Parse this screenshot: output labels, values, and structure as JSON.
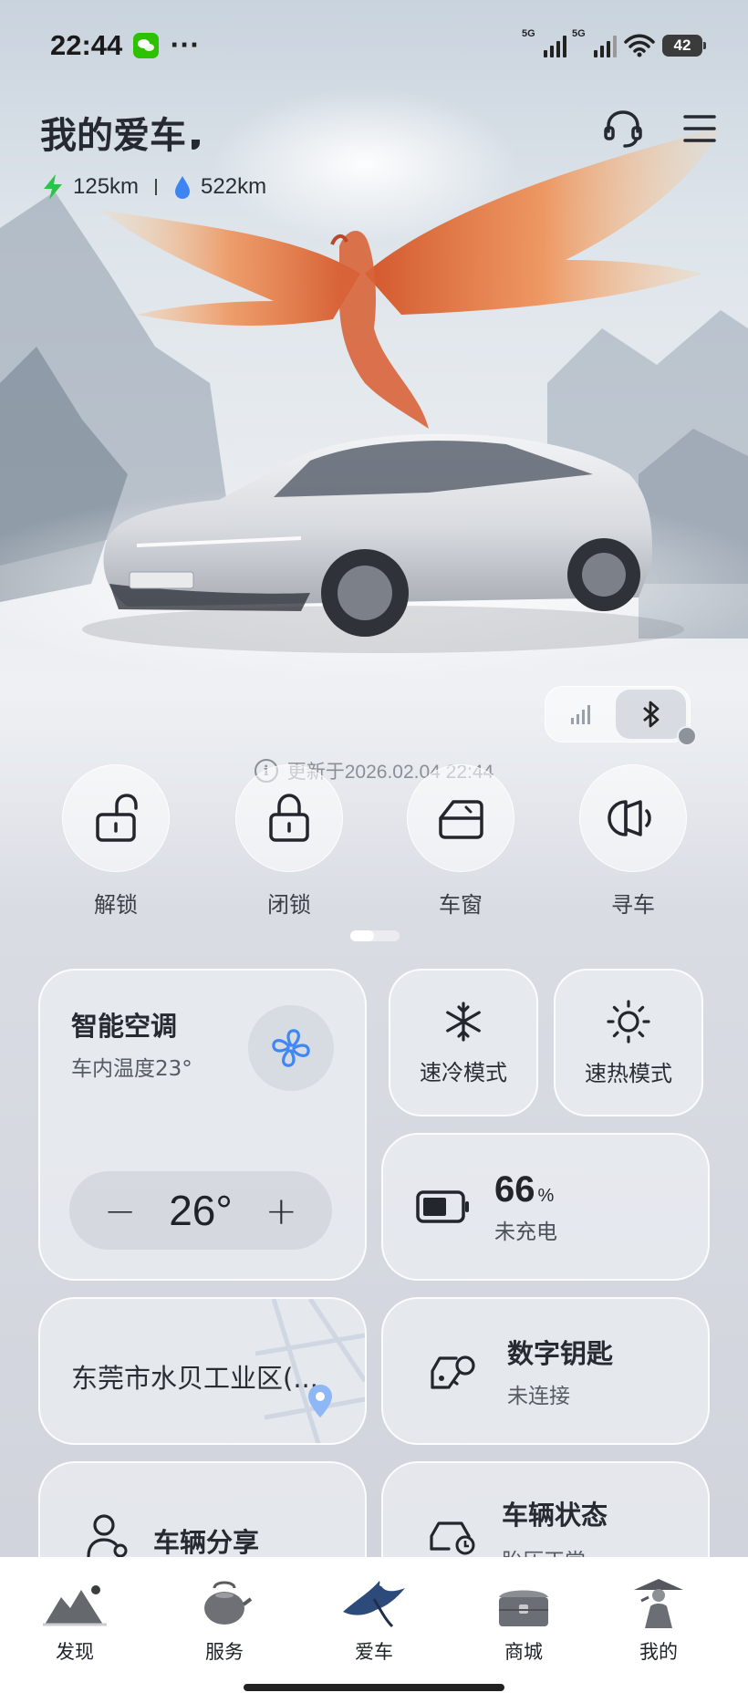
{
  "status_bar": {
    "time": "22:44",
    "network_1": "5G",
    "network_2": "5G",
    "battery_level": "42"
  },
  "header": {
    "title": "我的爱车",
    "electric_range": "125km",
    "fuel_range": "522km"
  },
  "sync": {
    "updated_text": "更新于2026.02.04 22:44"
  },
  "quick_actions": [
    {
      "label": "解锁",
      "icon": "unlock-icon"
    },
    {
      "label": "闭锁",
      "icon": "lock-icon"
    },
    {
      "label": "车窗",
      "icon": "window-icon"
    },
    {
      "label": "寻车",
      "icon": "horn-icon"
    }
  ],
  "climate": {
    "title": "智能空调",
    "cabin_temp": "车内温度23°",
    "set_temp": "26°",
    "minus": "−",
    "plus": "+"
  },
  "modes": {
    "quick_cool": "速冷模式",
    "quick_heat": "速热模式"
  },
  "battery": {
    "percent": "66",
    "unit": "%",
    "status": "未充电",
    "level": 0.66
  },
  "location": {
    "text": "东莞市水贝工业区(..."
  },
  "digital_key": {
    "title": "数字钥匙",
    "status": "未连接"
  },
  "share": {
    "title": "车辆分享"
  },
  "vehicle_status": {
    "title": "车辆状态",
    "sub": "胎压正常"
  },
  "bottom_nav": [
    {
      "label": "发现",
      "icon": "discover-icon"
    },
    {
      "label": "服务",
      "icon": "service-icon"
    },
    {
      "label": "爱车",
      "icon": "my-car-icon"
    },
    {
      "label": "商城",
      "icon": "mall-icon"
    },
    {
      "label": "我的",
      "icon": "profile-icon"
    }
  ],
  "colors": {
    "accent_blue": "#4a8df8",
    "charge_green": "#2fc24a",
    "fuel_blue": "#3d86f2"
  }
}
